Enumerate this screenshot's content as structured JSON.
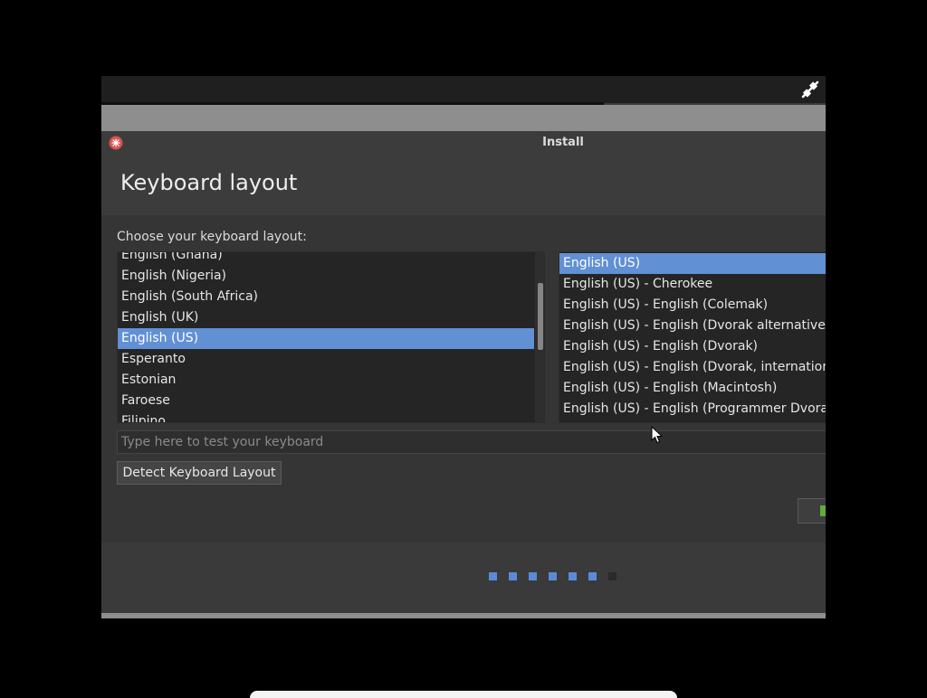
{
  "window": {
    "title": "Install"
  },
  "page": {
    "title": "Keyboard layout",
    "prompt": "Choose your keyboard layout:"
  },
  "layouts": {
    "items": [
      "English (Ghana)",
      "English (Nigeria)",
      "English (South Africa)",
      "English (UK)",
      "English (US)",
      "Esperanto",
      "Estonian",
      "Faroese",
      "Filipino"
    ],
    "selected_index": 4
  },
  "variants": {
    "items": [
      "English (US)",
      "English (US) - Cherokee",
      "English (US) - English (Colemak)",
      "English (US) - English (Dvorak alternative international no dead keys)",
      "English (US) - English (Dvorak)",
      "English (US) - English (Dvorak, international with dead keys)",
      "English (US) - English (Macintosh)",
      "English (US) - English (Programmer Dvorak)"
    ],
    "selected_index": 0
  },
  "test_input": {
    "placeholder": "Type here to test your keyboard",
    "value": ""
  },
  "buttons": {
    "detect_label": "Detect Keyboard Layout"
  },
  "progress": {
    "total_steps": 7,
    "completed_steps": 6
  },
  "colors": {
    "selection": "#6190d4",
    "step_done": "#5b8bd6",
    "step_pending": "#2a2a2a",
    "continue_indicator": "#5fae3a",
    "close_icon": "#d9534f"
  },
  "icons": {
    "close": "close-icon",
    "network": "network-icon",
    "cursor": "mouse-cursor-icon"
  }
}
